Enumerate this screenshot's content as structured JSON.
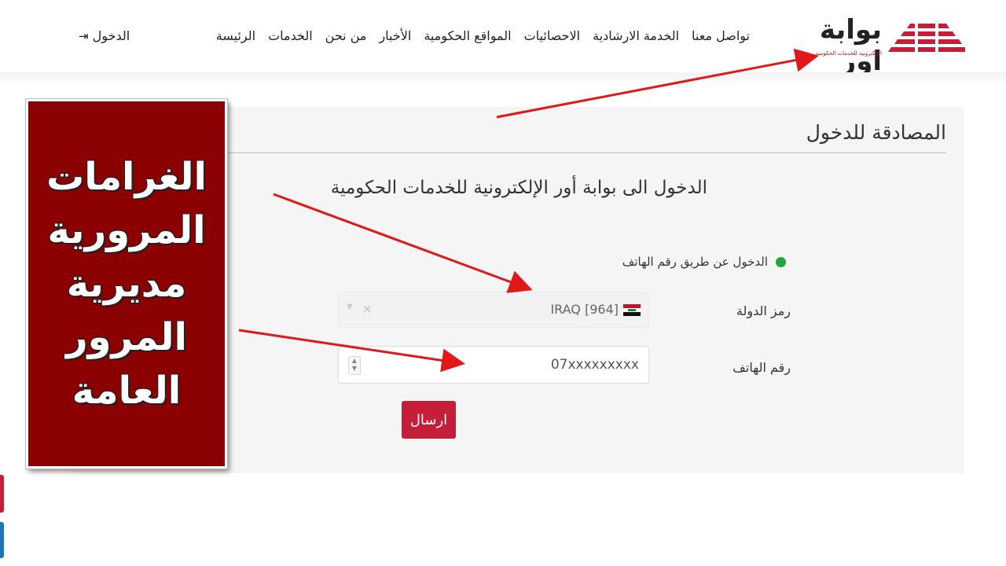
{
  "header": {
    "logo": {
      "title": "بوابة اور",
      "subtitle": "الإلكترونية للخدمات الحكومية"
    },
    "nav": [
      {
        "label": "الرئيسة"
      },
      {
        "label": "الخدمات"
      },
      {
        "label": "من نحن"
      },
      {
        "label": "الأخبار"
      },
      {
        "label": "المواقع الحكومية"
      },
      {
        "label": "الاحصائيات"
      },
      {
        "label": "الخدمة الارشادية"
      },
      {
        "label": "تواصل معنا"
      }
    ],
    "login_label": "الدخول",
    "login_icon": "sign-in-icon"
  },
  "card": {
    "title": "المصادقة للدخول",
    "subtitle": "الدخول الى بوابة أور الإلكترونية للخدمات الحكومية",
    "login_method": "الدخول عن طريق رقم الهاتف",
    "country_label": "رمز الدولة",
    "country_value": "IRAQ [964]",
    "phone_label": "رقم الهاتف",
    "phone_value": "07xxxxxxxxx",
    "submit_label": "ارسال"
  },
  "banner": {
    "lines": [
      "الغرامات",
      "المرورية",
      "مديرية",
      "المرور",
      "العامة"
    ]
  },
  "colors": {
    "accent": "#c41e3a",
    "banner_bg": "#8b0000",
    "status_dot": "#21a73a",
    "arrow": "#e01818"
  }
}
